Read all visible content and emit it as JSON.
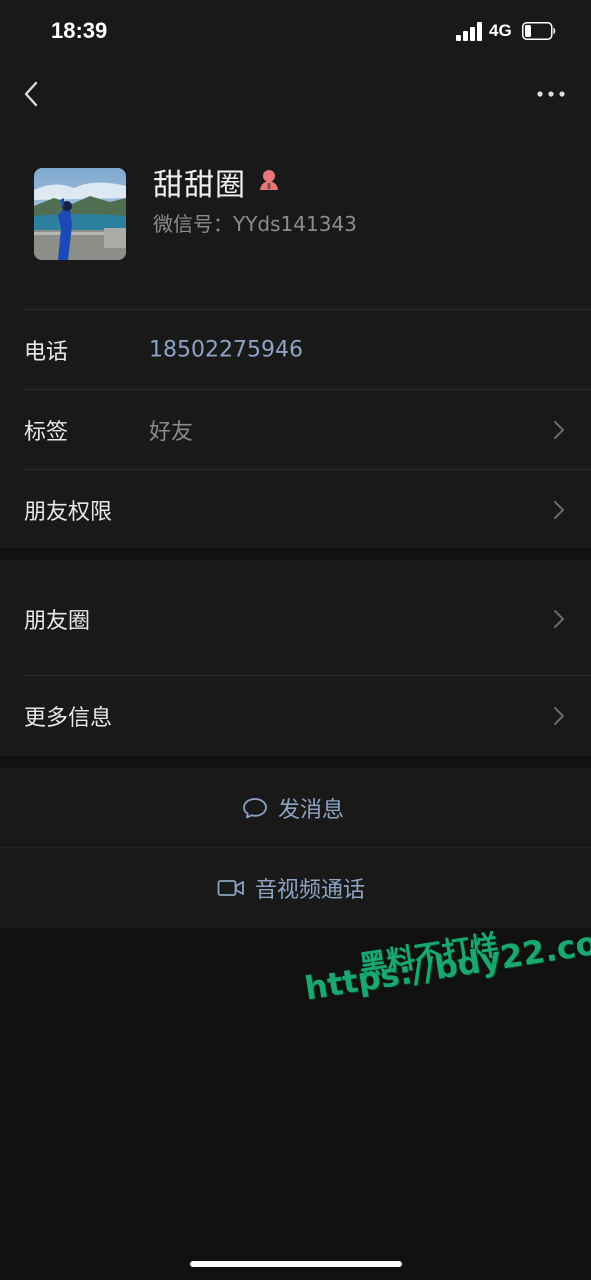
{
  "status_bar": {
    "time": "18:39",
    "network": "4G",
    "signal_icon": "cellular-signal-icon",
    "battery_icon": "battery-icon",
    "battery_level": 0.25
  },
  "nav": {
    "back_icon": "chevron-left-icon",
    "more_icon": "ellipsis-icon"
  },
  "profile": {
    "name": "甜甜圈",
    "gender_icon": "female-icon",
    "wechat_id": "微信号：YYds141343",
    "avatar": "profile-photo"
  },
  "rows": {
    "phone": {
      "label": "电话",
      "value": "18502275946"
    },
    "tag": {
      "label": "标签",
      "value": "好友"
    },
    "permissions": {
      "label": "朋友权限"
    },
    "moments": {
      "label": "朋友圈"
    },
    "more_info": {
      "label": "更多信息"
    }
  },
  "actions": {
    "message": {
      "label": "发消息",
      "icon": "chat-bubble-icon"
    },
    "call": {
      "label": "音视频通话",
      "icon": "video-camera-icon"
    }
  },
  "watermark": {
    "line1": "黑料不打烊",
    "line2": "https://bdy22.co"
  },
  "colors": {
    "background": "#111111",
    "surface": "#191919",
    "accent_link": "#8da3c4",
    "watermark": "#1aa870",
    "gender_icon": "#e87878"
  }
}
